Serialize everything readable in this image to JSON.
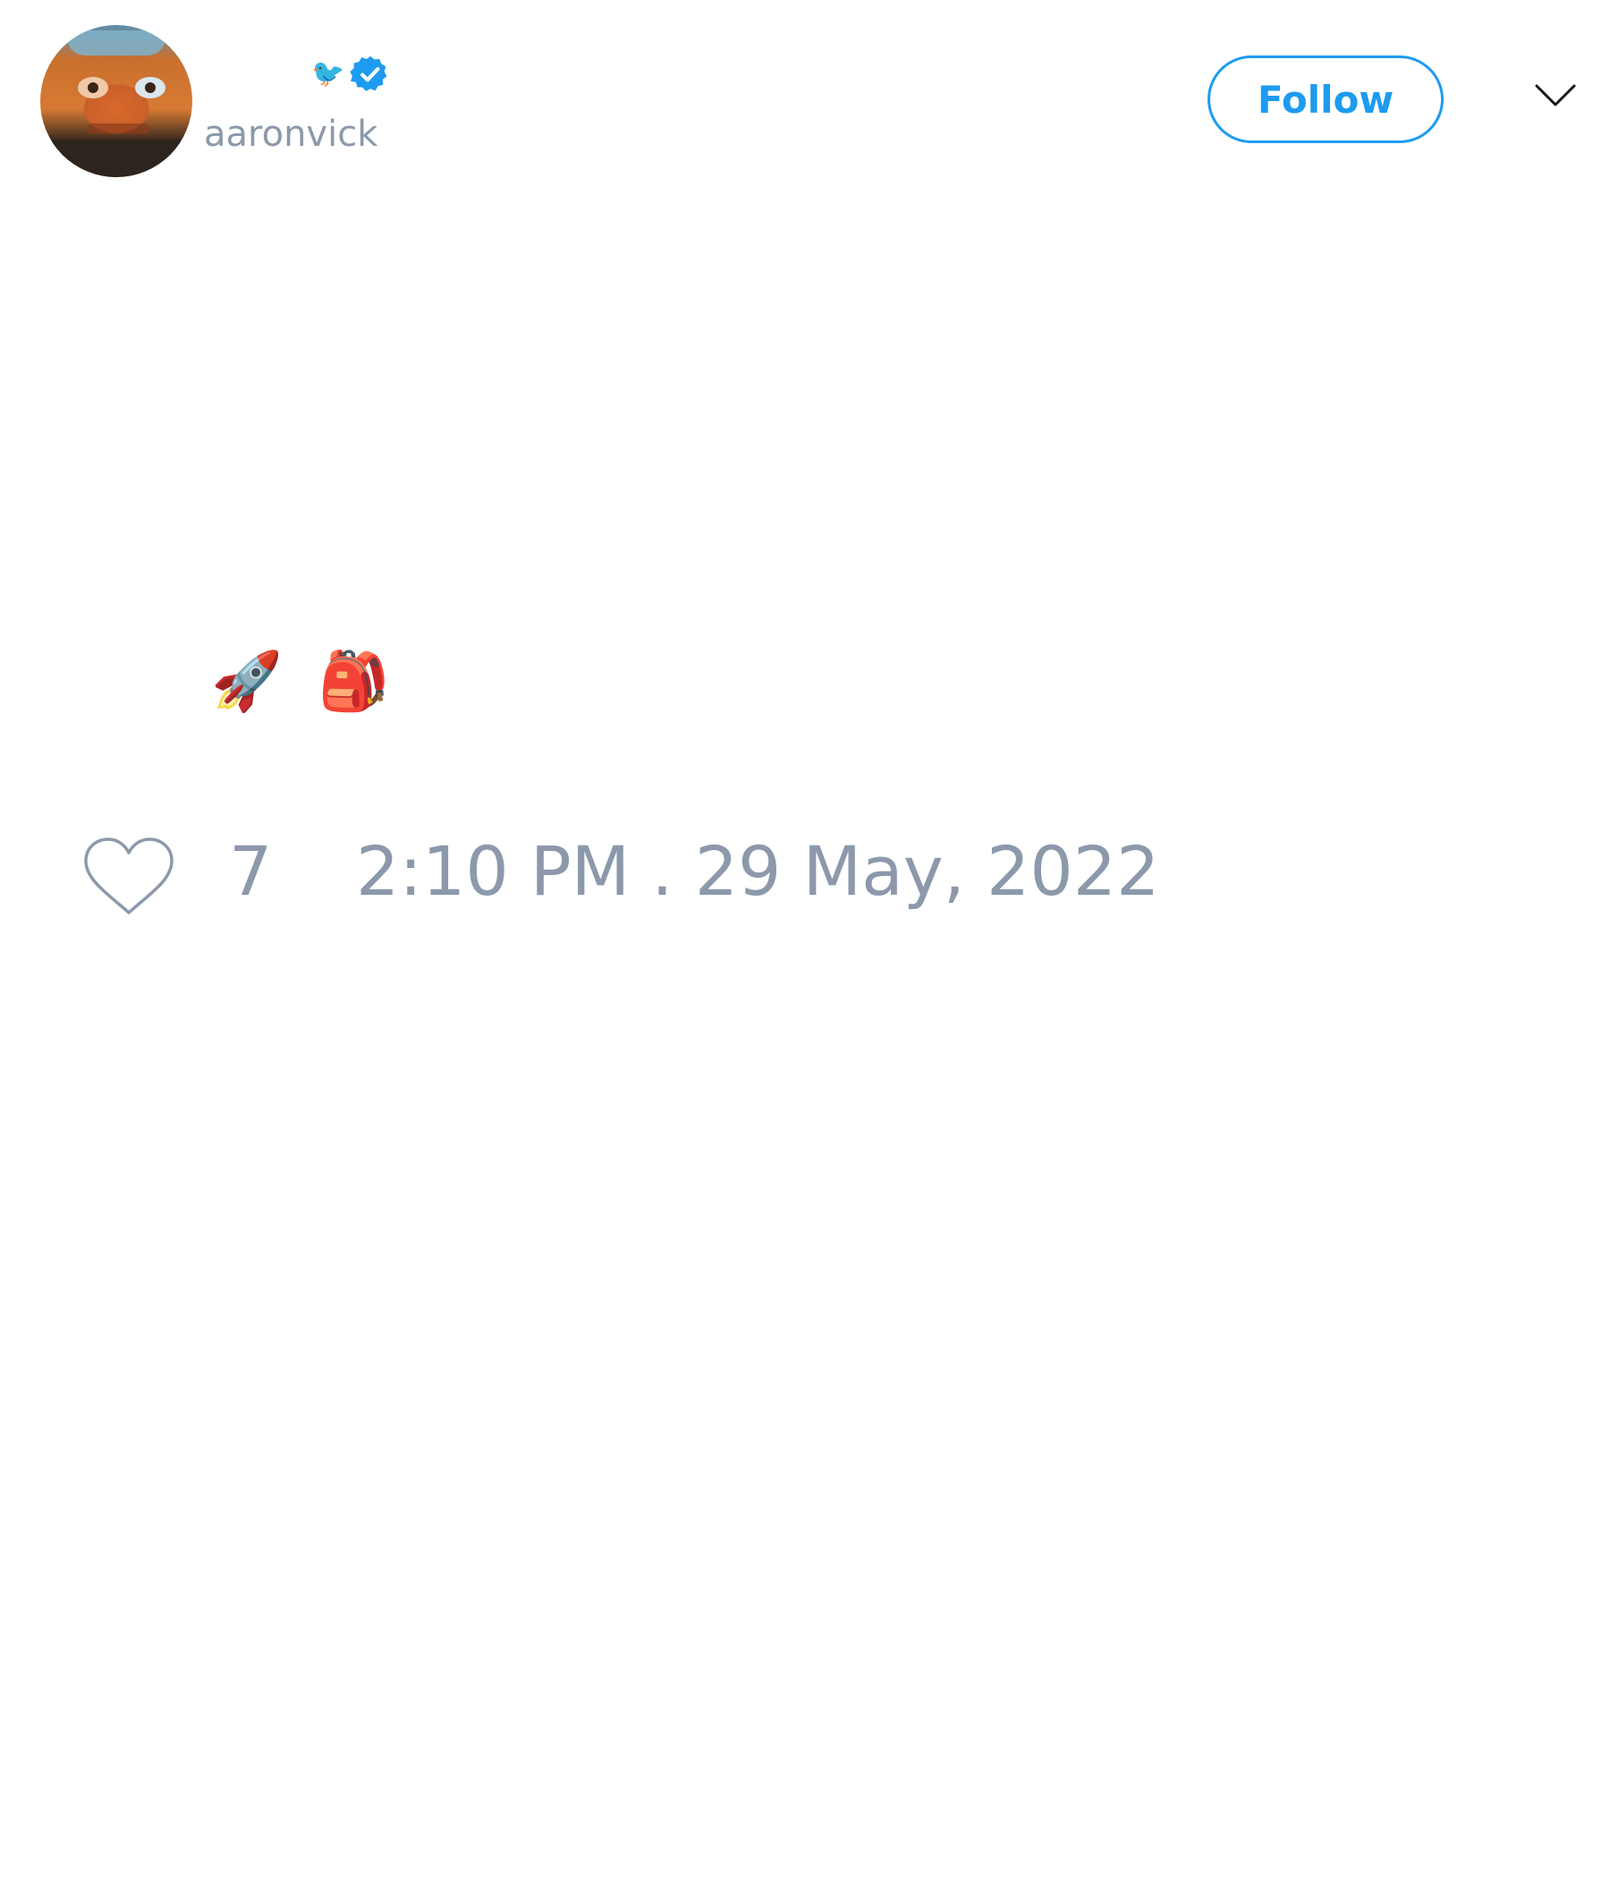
{
  "author": {
    "display_name_emoji": "🐦",
    "verified": true,
    "handle": "aaronvick"
  },
  "follow_button": {
    "label": "Follow"
  },
  "menu": {
    "icon": "chevron-down-icon"
  },
  "tweet": {
    "emojis": [
      "🚀",
      "🎒"
    ]
  },
  "stats": {
    "like_icon": "heart-icon",
    "like_count": "7",
    "timestamp": "2:10 PM . 29 May, 2022"
  },
  "colors": {
    "accent": "#1d9bf0",
    "muted_text": "#8c99ab",
    "background": "#ffffff"
  }
}
